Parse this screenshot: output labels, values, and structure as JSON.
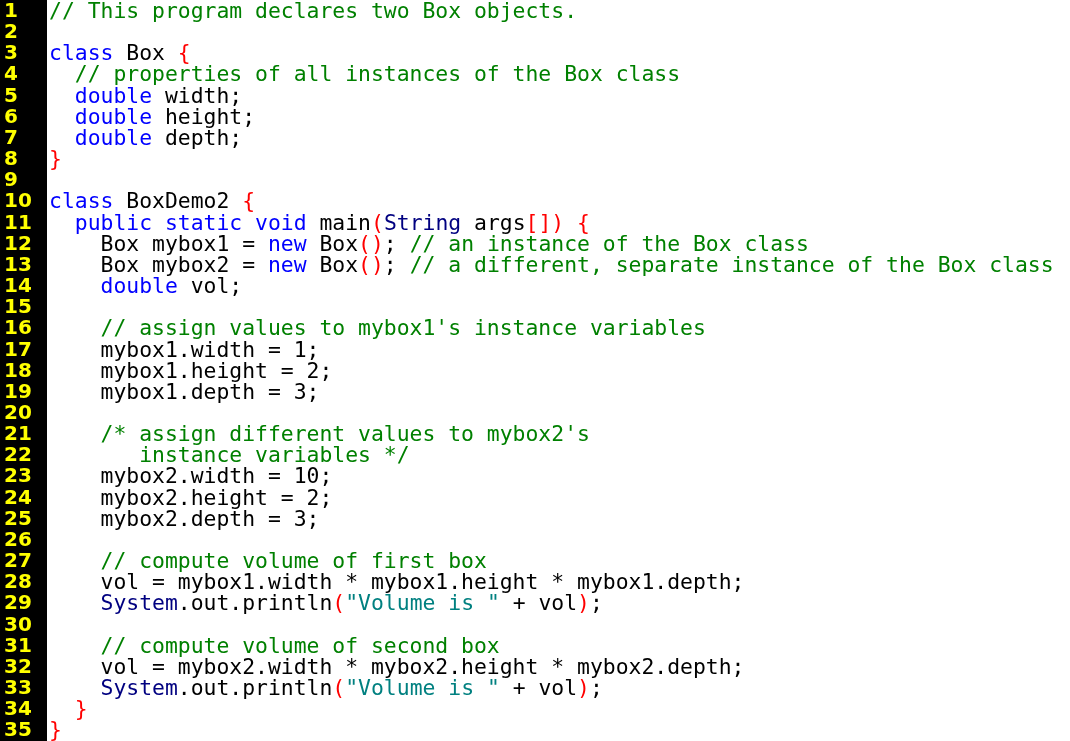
{
  "editor": {
    "lines": [
      {
        "number": "1",
        "tokens": [
          {
            "t": "// This program declares two Box objects.",
            "kind": "comment"
          }
        ]
      },
      {
        "number": "2"
      },
      {
        "number": "3",
        "tokens": [
          {
            "t": "class",
            "kind": "keyword"
          },
          {
            "t": " Box ",
            "kind": "plain"
          },
          {
            "t": "{",
            "kind": "bracket"
          }
        ]
      },
      {
        "number": "4",
        "tokens": [
          {
            "t": "  // properties of all instances of the Box class",
            "kind": "comment"
          }
        ]
      },
      {
        "number": "5",
        "tokens": [
          {
            "t": "  double",
            "kind": "keyword"
          },
          {
            "t": " width;",
            "kind": "plain"
          }
        ]
      },
      {
        "number": "6",
        "tokens": [
          {
            "t": "  double",
            "kind": "keyword"
          },
          {
            "t": " height;",
            "kind": "plain"
          }
        ]
      },
      {
        "number": "7",
        "tokens": [
          {
            "t": "  double",
            "kind": "keyword"
          },
          {
            "t": " depth;",
            "kind": "plain"
          }
        ]
      },
      {
        "number": "8",
        "tokens": [
          {
            "t": "}",
            "kind": "bracket"
          }
        ]
      },
      {
        "number": "9"
      },
      {
        "number": "10",
        "tokens": [
          {
            "t": "class",
            "kind": "keyword"
          },
          {
            "t": " BoxDemo2 ",
            "kind": "plain"
          },
          {
            "t": "{",
            "kind": "bracket"
          }
        ]
      },
      {
        "number": "11",
        "tokens": [
          {
            "t": "  public static void",
            "kind": "keyword"
          },
          {
            "t": " main",
            "kind": "plain"
          },
          {
            "t": "(",
            "kind": "bracket"
          },
          {
            "t": "String",
            "kind": "type"
          },
          {
            "t": " args",
            "kind": "plain"
          },
          {
            "t": "[]) {",
            "kind": "bracket"
          }
        ]
      },
      {
        "number": "12",
        "tokens": [
          {
            "t": "    Box mybox1 = ",
            "kind": "plain"
          },
          {
            "t": "new",
            "kind": "keyword"
          },
          {
            "t": " Box",
            "kind": "plain"
          },
          {
            "t": "()",
            "kind": "bracket"
          },
          {
            "t": "; ",
            "kind": "plain"
          },
          {
            "t": "// an instance of the Box class",
            "kind": "comment"
          }
        ]
      },
      {
        "number": "13",
        "tokens": [
          {
            "t": "    Box mybox2 = ",
            "kind": "plain"
          },
          {
            "t": "new",
            "kind": "keyword"
          },
          {
            "t": " Box",
            "kind": "plain"
          },
          {
            "t": "()",
            "kind": "bracket"
          },
          {
            "t": "; ",
            "kind": "plain"
          },
          {
            "t": "// a different, separate instance of the Box class",
            "kind": "comment"
          }
        ]
      },
      {
        "number": "14",
        "tokens": [
          {
            "t": "    double",
            "kind": "keyword"
          },
          {
            "t": " vol;",
            "kind": "plain"
          }
        ]
      },
      {
        "number": "15"
      },
      {
        "number": "16",
        "tokens": [
          {
            "t": "    // assign values to mybox1's instance variables",
            "kind": "comment"
          }
        ]
      },
      {
        "number": "17",
        "tokens": [
          {
            "t": "    mybox1.width = 1;",
            "kind": "plain"
          }
        ]
      },
      {
        "number": "18",
        "tokens": [
          {
            "t": "    mybox1.height = 2;",
            "kind": "plain"
          }
        ]
      },
      {
        "number": "19",
        "tokens": [
          {
            "t": "    mybox1.depth = 3;",
            "kind": "plain"
          }
        ]
      },
      {
        "number": "20"
      },
      {
        "number": "21",
        "tokens": [
          {
            "t": "    /* assign different values to mybox2's",
            "kind": "comment"
          }
        ]
      },
      {
        "number": "22",
        "tokens": [
          {
            "t": "       instance variables */",
            "kind": "comment"
          }
        ]
      },
      {
        "number": "23",
        "tokens": [
          {
            "t": "    mybox2.width = 10;",
            "kind": "plain"
          }
        ]
      },
      {
        "number": "24",
        "tokens": [
          {
            "t": "    mybox2.height = 2;",
            "kind": "plain"
          }
        ]
      },
      {
        "number": "25",
        "tokens": [
          {
            "t": "    mybox2.depth = 3;",
            "kind": "plain"
          }
        ]
      },
      {
        "number": "26"
      },
      {
        "number": "27",
        "tokens": [
          {
            "t": "    // compute volume of first box",
            "kind": "comment"
          }
        ]
      },
      {
        "number": "28",
        "tokens": [
          {
            "t": "    vol = mybox1.width * mybox1.height * mybox1.depth;",
            "kind": "plain"
          }
        ]
      },
      {
        "number": "29",
        "tokens": [
          {
            "t": "    System",
            "kind": "type"
          },
          {
            "t": ".out.println",
            "kind": "plain"
          },
          {
            "t": "(",
            "kind": "bracket"
          },
          {
            "t": "\"Volume is \"",
            "kind": "string"
          },
          {
            "t": " + vol",
            "kind": "plain"
          },
          {
            "t": ")",
            "kind": "bracket"
          },
          {
            "t": ";",
            "kind": "plain"
          }
        ]
      },
      {
        "number": "30"
      },
      {
        "number": "31",
        "tokens": [
          {
            "t": "    // compute volume of second box",
            "kind": "comment"
          }
        ]
      },
      {
        "number": "32",
        "tokens": [
          {
            "t": "    vol = mybox2.width * mybox2.height * mybox2.depth;",
            "kind": "plain"
          }
        ]
      },
      {
        "number": "33",
        "tokens": [
          {
            "t": "    System",
            "kind": "type"
          },
          {
            "t": ".out.println",
            "kind": "plain"
          },
          {
            "t": "(",
            "kind": "bracket"
          },
          {
            "t": "\"Volume is \"",
            "kind": "string"
          },
          {
            "t": " + vol",
            "kind": "plain"
          },
          {
            "t": ")",
            "kind": "bracket"
          },
          {
            "t": ";",
            "kind": "plain"
          }
        ]
      },
      {
        "number": "34",
        "tokens": [
          {
            "t": "  }",
            "kind": "bracket"
          }
        ]
      },
      {
        "number": "35",
        "tokens": [
          {
            "t": "}",
            "kind": "bracket"
          }
        ]
      }
    ]
  }
}
